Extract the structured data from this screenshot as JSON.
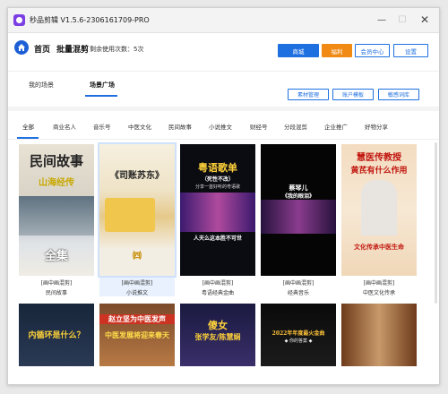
{
  "window": {
    "title": "秒品剪辑 V1.5.6-2306161709-PRO",
    "icon": "app-logo-icon",
    "controls": {
      "minimize": "—",
      "maximize": "☐",
      "close": "✕"
    }
  },
  "header": {
    "home_icon": "home-icon",
    "nav_home": "首页",
    "nav_batch": "批量混剪",
    "remaining": "剩余使用次数：5次",
    "buttons": {
      "mall": "商城",
      "benefit": "福利",
      "member": "会员中心",
      "settings": "设置"
    },
    "colors": {
      "primary": "#1e6fe0",
      "orange": "#f08a14"
    }
  },
  "scenes": {
    "tabs": [
      "我的场景",
      "场景广场"
    ],
    "active_tab": "场景广场",
    "actions": [
      "素材管理",
      "账户模板",
      "敏感词库"
    ]
  },
  "categories": {
    "items": [
      "全部",
      "商业名人",
      "音乐号",
      "中医文化",
      "民间故事",
      "小说推文",
      "财经号",
      "分段混剪",
      "企业推广",
      "好物分享"
    ],
    "active": "全部"
  },
  "cards": [
    {
      "thumb_title": "民间故事",
      "thumb_sub": "山海经传",
      "thumb_bottom": "全集",
      "tag": "[画中画混剪]",
      "name": "民间故事"
    },
    {
      "thumb_title": "《司账苏东》",
      "thumb_bottom": "㈣",
      "tag": "[画中画混剪]",
      "name": "小说推文"
    },
    {
      "thumb_title": "粤语歌单",
      "thumb_sub": "（死性不改）",
      "thumb_line": "分享一首好听的粤语歌",
      "thumb_bottom": "人天么这本胜不可世",
      "tag": "[画中画混剪]",
      "name": "粤语经典金曲"
    },
    {
      "thumb_title": "蔡琴儿",
      "thumb_sub": "《我的眼泪》",
      "tag": "[画中画混剪]",
      "name": "经典音乐"
    },
    {
      "thumb_title": "慧医传教授",
      "thumb_sub": "黄芪有什么作用",
      "thumb_bottom": "文化传承中医生命",
      "tag": "[画中画混剪]",
      "name": "中医文化传承"
    },
    {
      "thumb_title": "内循环是什么？",
      "tag": "",
      "name": ""
    },
    {
      "thumb_title": "赵立坚为中医发声",
      "thumb_sub": "中医发展将迎来春天",
      "tag": "",
      "name": ""
    },
    {
      "thumb_title": "傻女",
      "thumb_sub": "张学友/陈慧娴",
      "tag": "",
      "name": ""
    },
    {
      "thumb_title": "2022年年度最火金曲",
      "thumb_sub": "◆ 你的答案 ◆",
      "tag": "",
      "name": ""
    },
    {
      "thumb_title": "",
      "tag": "",
      "name": ""
    }
  ]
}
